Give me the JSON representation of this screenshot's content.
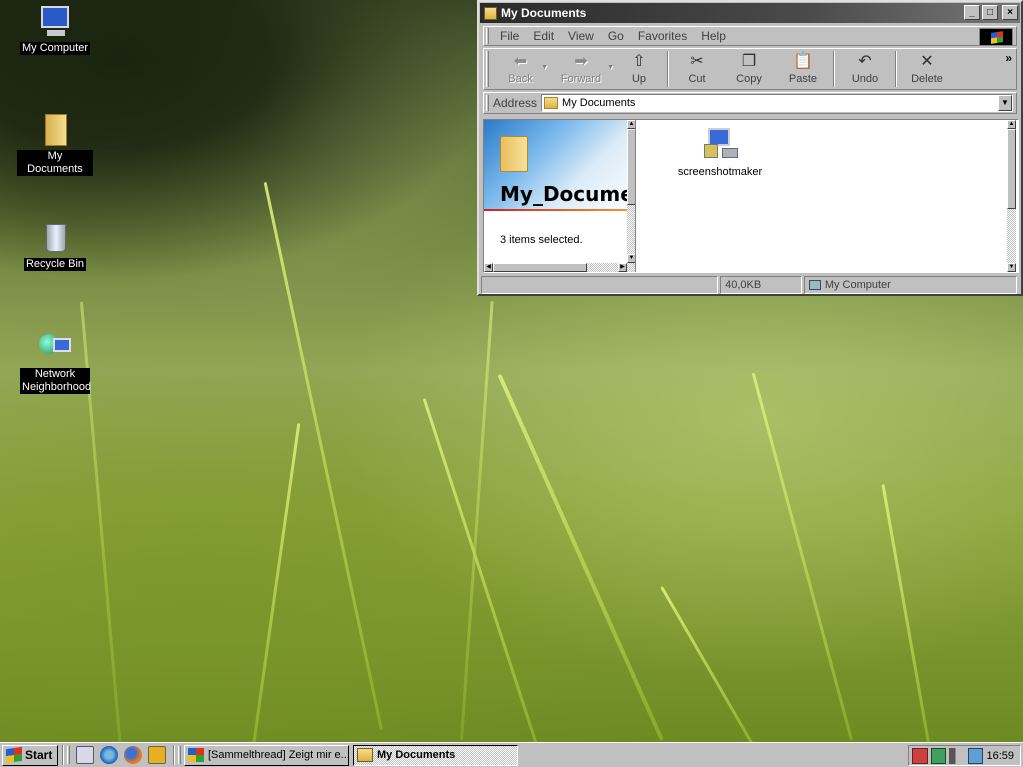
{
  "desktop": {
    "icons": [
      {
        "label": "My Computer"
      },
      {
        "label": "My Documents"
      },
      {
        "label": "Recycle Bin"
      },
      {
        "label": "Network Neighborhood"
      }
    ]
  },
  "window": {
    "title": "My Documents",
    "menu": [
      "File",
      "Edit",
      "View",
      "Go",
      "Favorites",
      "Help"
    ],
    "toolbar": {
      "back": "Back",
      "forward": "Forward",
      "up": "Up",
      "cut": "Cut",
      "copy": "Copy",
      "paste": "Paste",
      "undo": "Undo",
      "delete": "Delete"
    },
    "address": {
      "label": "Address",
      "value": "My Documents"
    },
    "left_pane": {
      "title": "My_Documents",
      "selection_text": "3 items selected."
    },
    "files": [
      {
        "name": "screenshotmaker"
      }
    ],
    "status": {
      "size": "40,0KB",
      "zone": "My Computer"
    }
  },
  "taskbar": {
    "start_label": "Start",
    "tasks": [
      {
        "label": "[Sammelthread] Zeigt mir e..."
      },
      {
        "label": "My Documents"
      }
    ],
    "clock": "16:59"
  }
}
